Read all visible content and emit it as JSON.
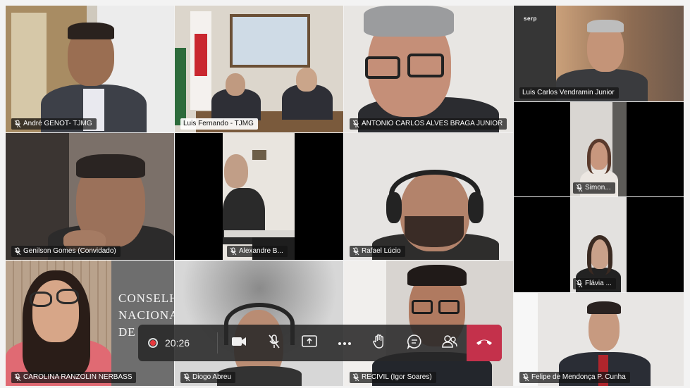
{
  "meeting": {
    "timer": "20:26"
  },
  "participants": [
    {
      "name": "André GENOT- TJMG"
    },
    {
      "name": "Luis Fernando - TJMG"
    },
    {
      "name": "ANTONIO CARLOS ALVES BRAGA JUNIOR"
    },
    {
      "name": "Luis Carlos Vendramin Junior"
    },
    {
      "name": "Genilson Gomes (Convidado)"
    },
    {
      "name": "Alexandre B..."
    },
    {
      "name": "Rafael Lúcio"
    },
    {
      "name": "Simon..."
    },
    {
      "name": "Flávia ..."
    },
    {
      "name": "CAROLINA RANZOLIN NERBASS"
    },
    {
      "name": "Diogo Abreu"
    },
    {
      "name": "RECIVIL (Igor Soares)"
    },
    {
      "name": "Felipe de Mendonça P. Cunha"
    }
  ],
  "background_text": {
    "serp_logo": "serp",
    "cnj_line1": "CONSELHO",
    "cnj_line2": "NACIONAL",
    "cnj_line3": "DE"
  },
  "toolbar": {
    "buttons": [
      "camera",
      "mic",
      "share",
      "more",
      "raise-hand",
      "chat",
      "participants",
      "leave"
    ]
  },
  "colors": {
    "hangup": "#c4314b",
    "record": "#e8383d",
    "toolbar_bg": "#282828"
  }
}
